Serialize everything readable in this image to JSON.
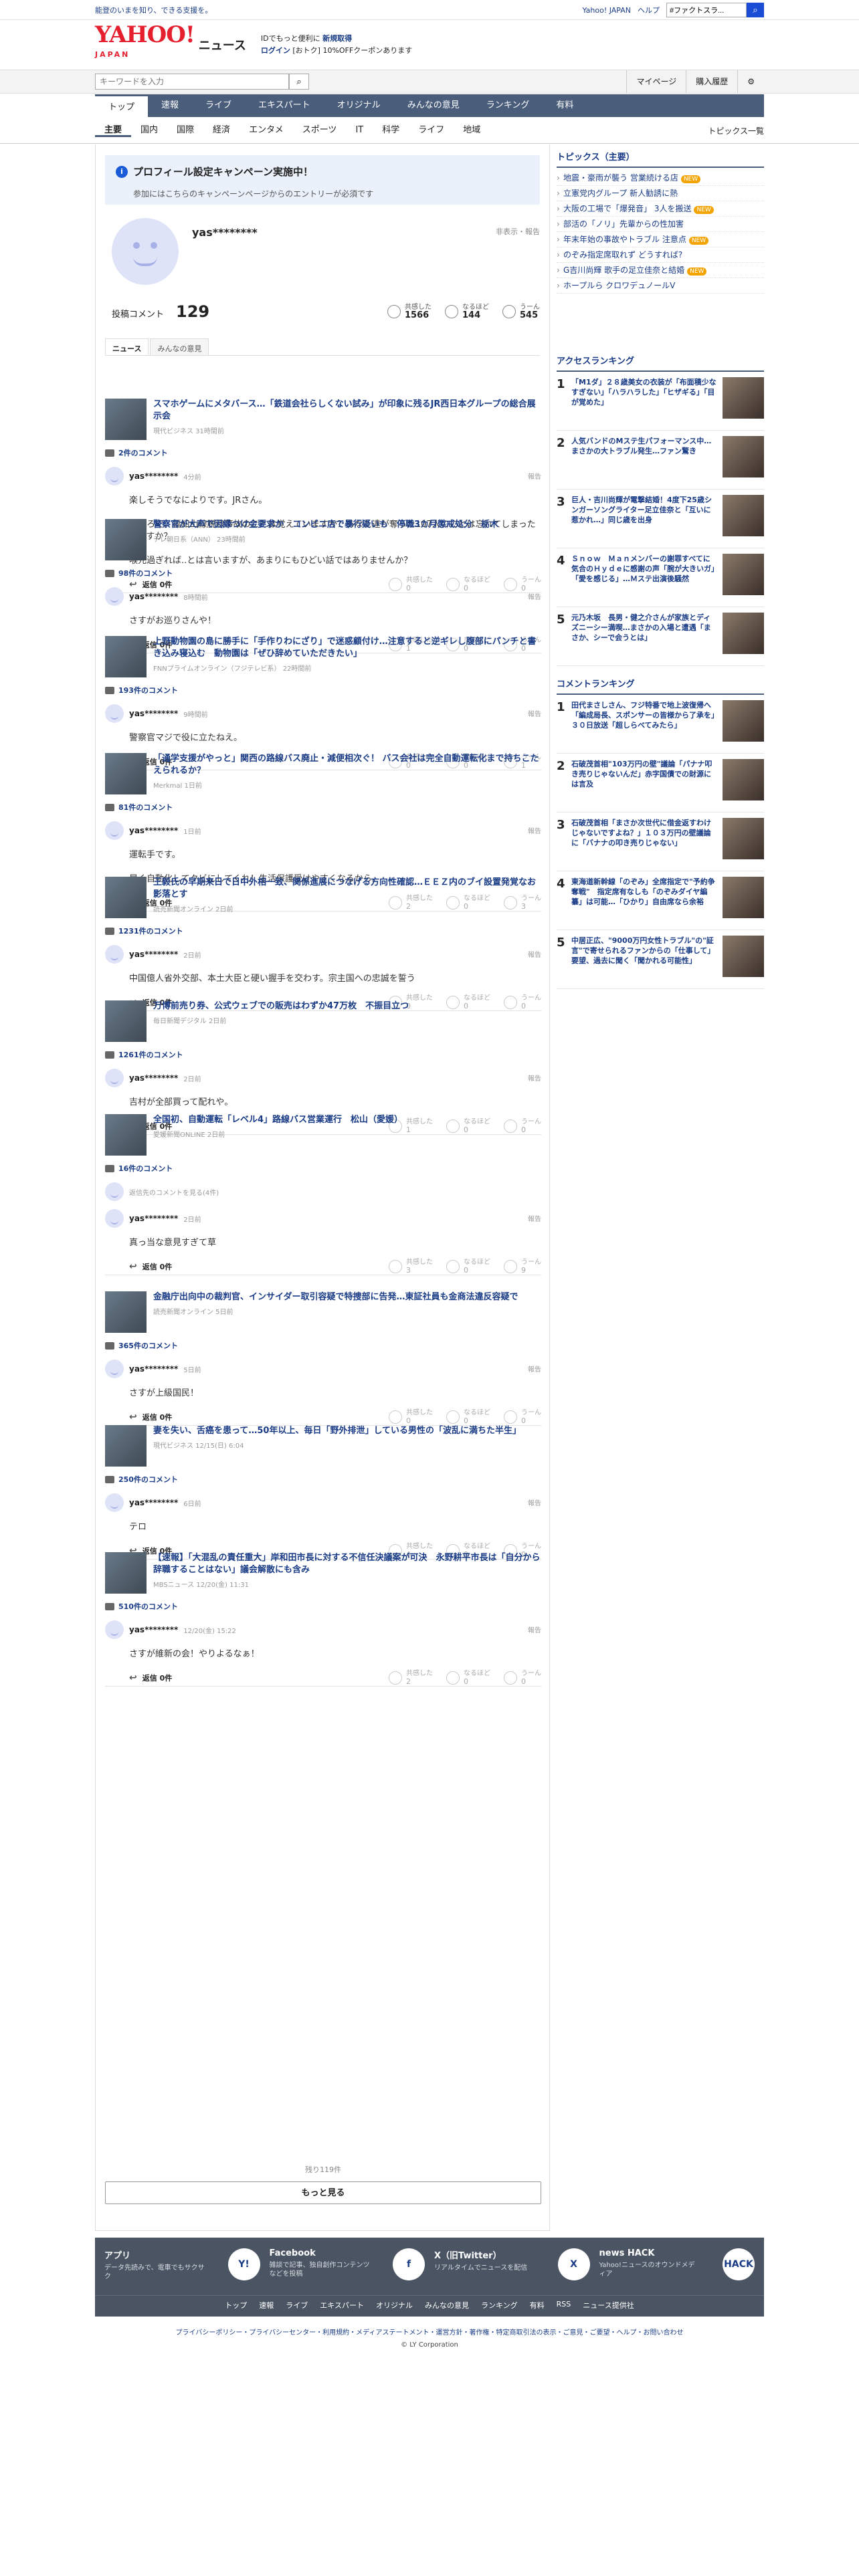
{
  "topbar": {
    "tagline": "能登のいまを知り、できる支援を。",
    "links": [
      "Yahoo! JAPAN",
      "ヘルプ"
    ],
    "search_placeholder": "ウェブ検索",
    "search_value": "#ファクトスラ..."
  },
  "header": {
    "logo": "YAHOO!",
    "logo_sub": "JAPAN",
    "brand": "ニュース",
    "login_msg": "IDでもっと便利に",
    "login_new": "新規取得",
    "login": "ログイン",
    "coupon": "[おトク] 10%OFFクーポンあります"
  },
  "searchbar": {
    "placeholder": "キーワードを入力",
    "mypage": "マイページ",
    "history": "購入履歴"
  },
  "gnav": [
    "トップ",
    "速報",
    "ライブ",
    "エキスパート",
    "オリジナル",
    "みんなの意見",
    "ランキング",
    "有料"
  ],
  "snav": [
    "主要",
    "国内",
    "国際",
    "経済",
    "エンタメ",
    "スポーツ",
    "IT",
    "科学",
    "ライフ",
    "地域"
  ],
  "snav_right": "トピックス一覧",
  "notice": {
    "title": "プロフィール設定キャンペーン実施中！",
    "sub": "参加にはこちらのキャンペーンページからのエントリーが必須です"
  },
  "profile": {
    "name": "yas********",
    "report": "非表示・報告",
    "comments_label": "投稿コメント",
    "comments": "129",
    "reactions": [
      {
        "label": "共感した",
        "value": "1566"
      },
      {
        "label": "なるほど",
        "value": "144"
      },
      {
        "label": "うーん",
        "value": "545"
      }
    ]
  },
  "tabs": [
    "ニュース",
    "みんなの意見"
  ],
  "entries": [
    {
      "title": "スマホゲームにメタバース…「鉄道会社らしくない試み」が印象に残るJR西日本グループの総合展示会",
      "src": "現代ビジネス 31時間前",
      "count": "2件のコメント",
      "user": "yas********",
      "time": "4分前",
      "body": "楽しそうでなによりです。JRさん。\n\nところで、福知山線脱線事故のことは覚えていますか？あなた達が奪った107人のことは忘れてしまったんですか？\n\n喉元過ぎれば..とは言いますが、あまりにもひどい話ではありませんか？",
      "reply": "返信 0件",
      "r": [
        "0",
        "0",
        "0"
      ]
    },
    {
      "title": "警察官が大声で因縁つけ金要求か　コンビニ店で暴行疑いも　停職3カ月懲戒処分　栃木",
      "src": "テレ朝日系（ANN） 23時間前",
      "count": "98件のコメント",
      "user": "yas********",
      "time": "8時間前",
      "body": "さすがお巡りさんや！",
      "reply": "返信 0件",
      "r": [
        "1",
        "0",
        "0"
      ]
    },
    {
      "title": "上野動物園の島に勝手に「手作りわにざり」で迷惑顧付け…注意すると逆ギレし腹部にパンチと書き込み寝込む　動物園は「ぜひ辞めていただきたい」",
      "src": "FNNプライムオンライン（フジテレビ系） 22時間前",
      "count": "193件のコメント",
      "user": "yas********",
      "time": "9時間前",
      "body": "警察官マジで役に立たねえ。",
      "reply": "返信 0件",
      "r": [
        "0",
        "0",
        "1"
      ]
    },
    {
      "title": "「通学支援がやっと」関西の路線バス廃止・減便相次ぐ！ バス会社は完全自動運転化まで持ちこたえられるか？",
      "src": "Merkmal 1日前",
      "count": "81件のコメント",
      "user": "yas********",
      "time": "1日前",
      "body": "運転手です。\n\n早く自動化してクビにしてくれ！生活保護受けやすくなるから。",
      "reply": "返信 0件",
      "r": [
        "2",
        "0",
        "3"
      ]
    },
    {
      "title": "王毅氏の早期来日で日中外相一致、関係進展につなげる方向性確認…ＥＥＺ内のブイ設置発覚なお影落とす",
      "src": "読売新聞オンライン 2日前",
      "count": "1231件のコメント",
      "user": "yas********",
      "time": "2日前",
      "body": "中国億人省外交部、本土大臣と硬い握手を交わす。宗主国への忠誠を誓う",
      "reply": "返信 0件",
      "r": [
        "0",
        "0",
        "0"
      ]
    },
    {
      "title": "万博前売り券、公式ウェブでの販売はわずか47万枚　不振目立つ",
      "src": "毎日新聞デジタル 2日前",
      "count": "1261件のコメント",
      "user": "yas********",
      "time": "2日前",
      "body": "吉村が全部買って配れや。",
      "reply": "返信 0件",
      "r": [
        "1",
        "0",
        "0"
      ]
    },
    {
      "title": "全国初、自動運転「レベル4」路線バス営業運行　松山（愛媛）",
      "src": "愛媛新聞ONLINE 2日前",
      "count": "16件のコメント",
      "user": "yas********",
      "time": "2日前",
      "body": "真っ当な意見すぎて草",
      "reply": "返信 0件",
      "r": [
        "3",
        "0",
        "9"
      ],
      "prev": "返信先のコメントを見る(4件)"
    },
    {
      "title": "金融庁出向中の裁判官、インサイダー取引容疑で特捜部に告発…東証社員も金商法違反容疑で",
      "src": "読売新聞オンライン 5日前",
      "count": "365件のコメント",
      "user": "yas********",
      "time": "5日前",
      "body": "さすが上級国民！",
      "reply": "返信 0件",
      "r": [
        "0",
        "0",
        "0"
      ]
    },
    {
      "title": "妻を失い、舌癌を患って…50年以上、毎日「野外排泄」している男性の「波乱に満ちた半生」",
      "src": "現代ビジネス 12/15(日) 6:04",
      "count": "250件のコメント",
      "user": "yas********",
      "time": "6日前",
      "body": "テロ",
      "reply": "返信 0件",
      "r": [
        "4",
        "0",
        "0"
      ]
    },
    {
      "title": "【速報】「大混乱の責任重大」岸和田市長に対する不信任決議案が可決　永野耕平市長は「自分から辞職することはない」議会解散にも含み",
      "src": "MBSニュース 12/20(金) 11:31",
      "count": "510件のコメント",
      "user": "yas********",
      "time": "12/20(金) 15:22",
      "body": "さすが維新の会！やりよるなぁ！",
      "reply": "返信 0件",
      "r": [
        "2",
        "0",
        "0"
      ]
    }
  ],
  "more": {
    "remaining": "残り119件",
    "button": "もっと見る"
  },
  "side": {
    "topics_title": "トピックス（主要）",
    "topics": [
      {
        "t": "地震・豪雨が襲う 営業続ける店",
        "tag": "NEW"
      },
      {
        "t": "立憲党内グループ 新人勧誘に熱",
        "tag": ""
      },
      {
        "t": "大阪の工場で「爆発音」 3人を搬送",
        "tag": "NEW"
      },
      {
        "t": "部活の「ノリ」先輩からの性加害",
        "tag": ""
      },
      {
        "t": "年末年始の事故やトラブル 注意点",
        "tag": "NEW"
      },
      {
        "t": "のぞみ指定席取れず どうすれば?",
        "tag": ""
      },
      {
        "t": "G吉川尚輝 歌手の足立佳奈と結婚",
        "tag": "NEW"
      },
      {
        "t": "ホープルら クロワデュノールV",
        "tag": ""
      }
    ],
    "access_title": "アクセスランキング",
    "access": [
      {
        "t": "「M1ダ」２８歳美女の衣装が「布面積少なすぎない」「ハラハラした」「ヒザギる」「目が覚めた」",
        "s": "スポーツ報知 12/28(土) 13:30"
      },
      {
        "t": "人気バンドのMステ生パフォーマンス中…まさかの大トラブル発生…ファン驚き",
        "s": "スポニチアネックス 12/28(土) 15:08"
      },
      {
        "t": "巨人・吉川尚輝が電撃結婚！4度下25歳シンガーソングライター足立佳奈と「互いに惹かれ…」同じ歳を出身",
        "s": "スポニチアネックス 12/28(土) 17:00"
      },
      {
        "t": "Ｓｎｏｗ　Ｍａｎメンバーの謝罪すべてに気合のＨｙｄｅに感謝の声「腕が大きいガ」「愛を感じる」…Ｍステ出演後騒然",
        "s": "スポーツ報知 12/28(土) 15:42"
      },
      {
        "t": "元乃木坂　長男・健之介さんが家族とディズニーシー満喫…まさかの入場と遭遇「まさか、シーで会うとは」",
        "s": "スポニチアネックス 12/28(土) 15:44"
      }
    ],
    "comment_title": "コメントランキング",
    "comment": [
      {
        "t": "田代まさしさん、フジ特番で地上波復帰へ「編成局長、スポンサーの皆様から了承を」３０日放送「超しらべてみたら」",
        "s": "スポーツ報知 12/28(土) 13:16"
      },
      {
        "t": "石破茂首相\"103万円の壁\"議論「パナナ叩き売りじゃないんだ」赤字国債での財源には言及",
        "s": "スポニチアネックス 12/28(土) 15:47"
      },
      {
        "t": "石破茂首相「まさか次世代に借金返すわけじゃないですよね？」１０３万円の壁議論に「バナナの叩き売りじゃない」",
        "s": "デイリースポーツ 12/28(土) 16:50"
      },
      {
        "t": "東海道新幹線「のぞみ」全席指定で\"予約争奪戦\"　指定席有なしも「のぞみダイヤ編纂」は可能…「ひかり」自由席なら余裕",
        "s": "FNNプライムオンライン 12/28(土) 15:43"
      },
      {
        "t": "中居正広、\"9000万円女性トラブル\"の\"証言\"で寄せられるファンからの「仕事して」要望、過去に聞く「聞かれる可能性」",
        "s": "SmartFLASH 12/28(土) 17:45"
      }
    ]
  },
  "footer": {
    "apps": [
      {
        "t": "アプリ",
        "s": "データ先読みで、電車でもサクサク",
        "i": "Y!"
      },
      {
        "t": "Facebook",
        "s": "雑談で記事、独自創作コンテンツなどを投稿",
        "i": "f"
      },
      {
        "t": "X（旧Twitter）",
        "s": "リアルタイムでニュースを配信",
        "i": "X"
      },
      {
        "t": "news HACK",
        "s": "Yahoo!ニュースのオウンドメディア",
        "i": "HACK"
      }
    ],
    "links": [
      "トップ",
      "速報",
      "ライブ",
      "エキスパート",
      "オリジナル",
      "みんなの意見",
      "ランキング",
      "有料",
      "RSS",
      "ニュース提供社"
    ]
  },
  "legal": {
    "links": "プライバシーポリシー・プライバシーセンター・利用規約・メディアステートメント・運営方針・著作権・特定商取引法の表示・ご意見・ご要望・ヘルプ・お問い合わせ",
    "copy": "© LY Corporation"
  }
}
